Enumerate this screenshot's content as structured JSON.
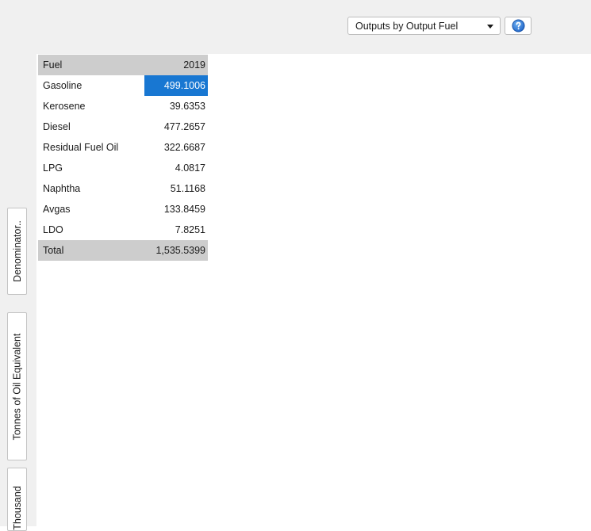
{
  "toolbar": {
    "view_selector": {
      "selected": "Outputs by Output Fuel"
    },
    "help_icon": "help-question-icon",
    "accent_color": "#1877d2"
  },
  "side_tabs": [
    "Denominator..",
    "Tonnes of Oil Equivalent",
    "Thousand"
  ],
  "table": {
    "header": {
      "label": "Fuel",
      "year": "2019"
    },
    "rows": [
      {
        "label": "Gasoline",
        "value": "499.1006",
        "selected": true
      },
      {
        "label": "Kerosene",
        "value": "39.6353"
      },
      {
        "label": "Diesel",
        "value": "477.2657"
      },
      {
        "label": "Residual Fuel Oil",
        "value": "322.6687"
      },
      {
        "label": "LPG",
        "value": "4.0817"
      },
      {
        "label": "Naphtha",
        "value": "51.1168"
      },
      {
        "label": "Avgas",
        "value": "133.8459"
      },
      {
        "label": "LDO",
        "value": "7.8251"
      }
    ],
    "total": {
      "label": "Total",
      "value": "1,535.5399"
    }
  }
}
